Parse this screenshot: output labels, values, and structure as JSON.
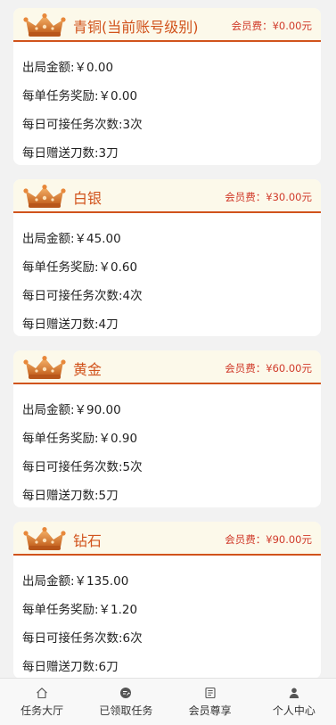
{
  "levels": [
    {
      "name": "青铜(当前账号级别)",
      "fee": "会员费：¥0.00元",
      "rows": [
        "出局金额:￥0.00",
        "每单任务奖励:￥0.00",
        "每日可接任务次数:3次",
        "每日赠送刀数:3刀"
      ]
    },
    {
      "name": "白银",
      "fee": "会员费：¥30.00元",
      "rows": [
        "出局金额:￥45.00",
        "每单任务奖励:￥0.60",
        "每日可接任务次数:4次",
        "每日赠送刀数:4刀"
      ]
    },
    {
      "name": "黄金",
      "fee": "会员费：¥60.00元",
      "rows": [
        "出局金额:￥90.00",
        "每单任务奖励:￥0.90",
        "每日可接任务次数:5次",
        "每日赠送刀数:5刀"
      ]
    },
    {
      "name": "钻石",
      "fee": "会员费：¥90.00元",
      "rows": [
        "出局金额:￥135.00",
        "每单任务奖励:￥1.20",
        "每日可接任务次数:6次",
        "每日赠送刀数:6刀"
      ]
    }
  ],
  "tabbar": {
    "tabs": [
      {
        "label": "任务大厅",
        "icon": "home-icon"
      },
      {
        "label": "已领取任务",
        "icon": "task-received-icon"
      },
      {
        "label": "会员尊享",
        "icon": "member-card-icon"
      },
      {
        "label": "个人中心",
        "icon": "user-icon"
      }
    ]
  },
  "colors": {
    "accent": "#d1531c",
    "fee": "#d03a2a",
    "header_bg": "#fcf9ea",
    "page_bg": "#f2f2f2"
  }
}
